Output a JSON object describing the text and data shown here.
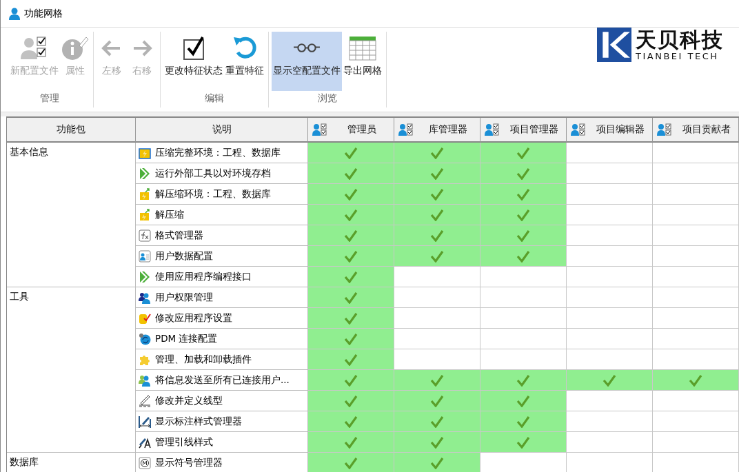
{
  "window": {
    "title": "功能网格"
  },
  "toolbar": {
    "groups": [
      {
        "label": "管理",
        "buttons": [
          {
            "label": "新配置文件",
            "kind": "new-profile",
            "disabled": true,
            "selected": false
          },
          {
            "label": "属性",
            "kind": "properties",
            "disabled": true,
            "selected": false
          }
        ]
      },
      {
        "buttons": [
          {
            "label": "左移",
            "kind": "left",
            "disabled": true,
            "selected": false
          },
          {
            "label": "右移",
            "kind": "right",
            "disabled": true,
            "selected": false
          }
        ]
      },
      {
        "label": "编辑",
        "buttons": [
          {
            "label": "更改特征状态",
            "kind": "check",
            "disabled": false,
            "selected": false
          },
          {
            "label": "重置特征",
            "kind": "reset",
            "disabled": false,
            "selected": false
          }
        ]
      },
      {
        "label": "浏览",
        "buttons": [
          {
            "label": "显示空配置文件",
            "kind": "glasses",
            "disabled": false,
            "selected": true
          },
          {
            "label": "导出网格",
            "kind": "grid",
            "disabled": false,
            "selected": false
          }
        ]
      }
    ]
  },
  "logo": {
    "name": "天贝科技",
    "subtitle": "TIANBEI TECH"
  },
  "table": {
    "columns": [
      "功能包",
      "说明"
    ],
    "roles": [
      "管理员",
      "库管理器",
      "项目管理器",
      "项目编辑器",
      "项目贡献者"
    ],
    "groups": [
      {
        "name": "基本信息",
        "rows": [
          {
            "desc": "压缩完整环境：工程、数据库",
            "kind": "archive",
            "grants": [
              true,
              true,
              true,
              false,
              false
            ]
          },
          {
            "desc": "运行外部工具以对环境存档",
            "kind": "run",
            "grants": [
              true,
              true,
              true,
              false,
              false
            ]
          },
          {
            "desc": "解压缩环境：工程、数据库",
            "kind": "extract",
            "grants": [
              true,
              true,
              true,
              false,
              false
            ]
          },
          {
            "desc": "解压缩",
            "kind": "extract",
            "grants": [
              true,
              true,
              true,
              false,
              false
            ]
          },
          {
            "desc": "格式管理器",
            "kind": "fx",
            "grants": [
              true,
              true,
              true,
              false,
              false
            ]
          },
          {
            "desc": "用户数据配置",
            "kind": "user-card",
            "grants": [
              true,
              true,
              true,
              false,
              false
            ]
          },
          {
            "desc": "使用应用程序编程接口",
            "kind": "run",
            "grants": [
              true,
              false,
              false,
              false,
              false
            ]
          }
        ]
      },
      {
        "name": "工具",
        "rows": [
          {
            "desc": "用户权限管理",
            "kind": "users",
            "grants": [
              true,
              false,
              false,
              false,
              false
            ]
          },
          {
            "desc": "修改应用程序设置",
            "kind": "db-check",
            "grants": [
              true,
              false,
              false,
              false,
              false
            ]
          },
          {
            "desc": "PDM 连接配置",
            "kind": "sync",
            "grants": [
              true,
              false,
              false,
              false,
              false
            ]
          },
          {
            "desc": "管理、加载和卸载插件",
            "kind": "puzzle",
            "grants": [
              true,
              false,
              false,
              false,
              false
            ]
          },
          {
            "desc": "将信息发送至所有已连接用户...",
            "kind": "users-green",
            "grants": [
              true,
              true,
              true,
              true,
              true
            ]
          },
          {
            "desc": "修改并定义线型",
            "kind": "pen-line",
            "grants": [
              true,
              true,
              true,
              false,
              false
            ]
          },
          {
            "desc": "显示标注样式管理器",
            "kind": "dimension",
            "grants": [
              true,
              true,
              true,
              false,
              false
            ]
          },
          {
            "desc": "管理引线样式",
            "kind": "pen-a",
            "grants": [
              true,
              true,
              true,
              false,
              false
            ]
          }
        ]
      },
      {
        "name": "数据库",
        "rows": [
          {
            "desc": "显示符号管理器",
            "kind": "symbol",
            "grants": [
              true,
              true,
              false,
              false,
              false
            ]
          }
        ]
      }
    ]
  }
}
